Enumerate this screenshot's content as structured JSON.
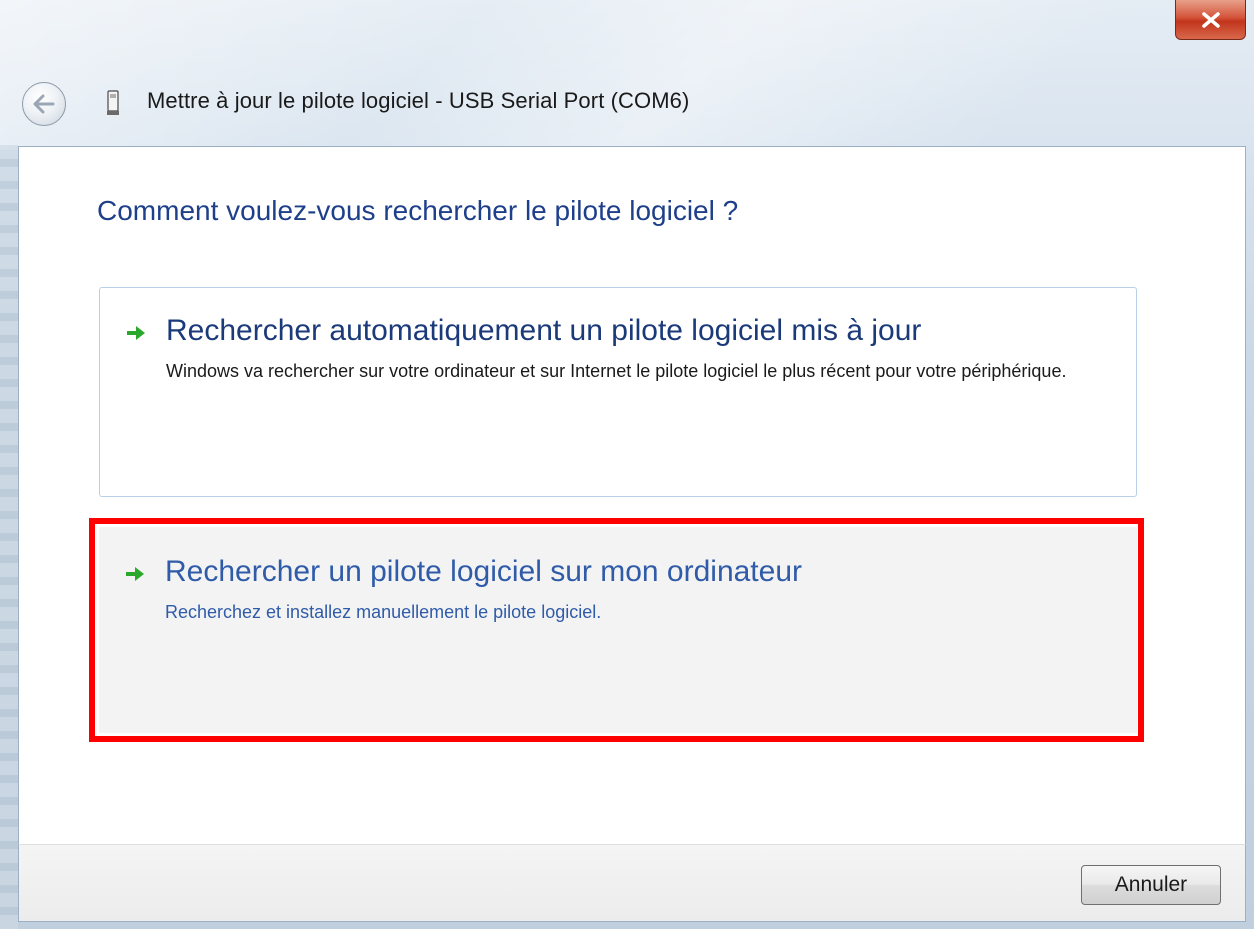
{
  "window": {
    "title": "Mettre à jour le pilote logiciel - USB Serial Port (COM6)",
    "close_icon": "close-icon",
    "back_icon": "back-arrow-icon",
    "device_icon": "usb-device-icon"
  },
  "main": {
    "heading": "Comment voulez-vous rechercher le pilote logiciel ?",
    "options": [
      {
        "title": "Rechercher automatiquement un pilote logiciel mis à jour",
        "description": "Windows va rechercher sur votre ordinateur et sur Internet le pilote logiciel le plus récent pour votre périphérique.",
        "icon": "green-arrow-icon"
      },
      {
        "title": "Rechercher un pilote logiciel sur mon ordinateur",
        "description": "Recherchez et installez manuellement le pilote logiciel.",
        "icon": "green-arrow-icon",
        "highlighted": true
      }
    ]
  },
  "footer": {
    "cancel_label": "Annuler"
  },
  "colors": {
    "heading": "#1e3f8a",
    "link_hover": "#2f5ba8",
    "arrow": "#2ba82b",
    "highlight_border": "#ff0000",
    "close_button": "#c1351c"
  }
}
